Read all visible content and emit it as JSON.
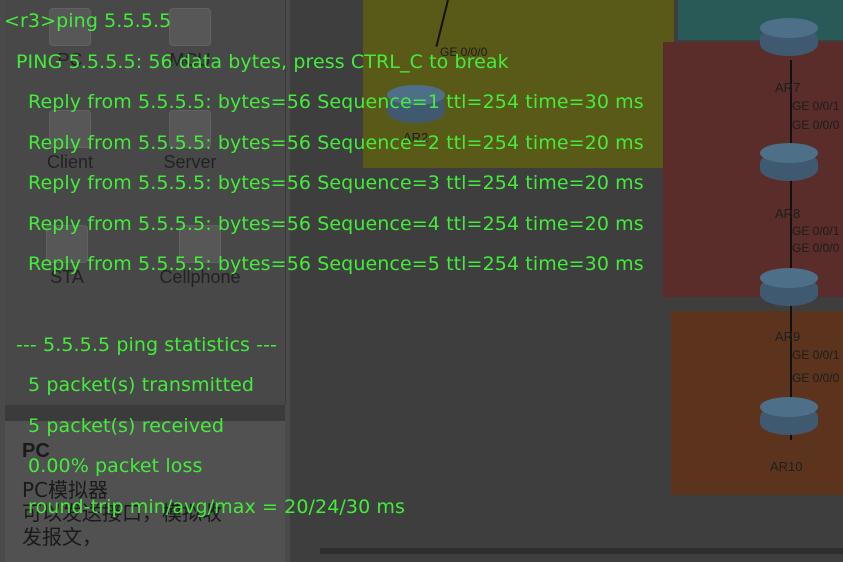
{
  "background": {
    "device_palette": [
      {
        "label": "PC",
        "icon": "pc-icon"
      },
      {
        "label": "MCU",
        "icon": "mcu-icon"
      },
      {
        "label": "Client",
        "icon": "client-icon"
      },
      {
        "label": "Server",
        "icon": "server-icon"
      },
      {
        "label": "STA",
        "icon": "sta-icon"
      },
      {
        "label": "Cellphone",
        "icon": "cellphone-icon"
      }
    ],
    "description": {
      "title": "PC",
      "lines": [
        "PC模拟器",
        "可以发送接口，模拟收",
        "发报文，"
      ]
    },
    "routers": [
      {
        "label": "AR7",
        "ports": [
          "GE 0/0/1",
          "GE 0/0/0"
        ]
      },
      {
        "label": "AR8",
        "ports": [
          "GE 0/0/1",
          "GE 0/0/0"
        ]
      },
      {
        "label": "AR9",
        "ports": [
          "GE 0/0/1",
          "GE 0/0/0"
        ]
      },
      {
        "label": "AR10",
        "ports": []
      },
      {
        "label": "AR2",
        "ports": [
          "GE 0/0/0"
        ]
      }
    ],
    "top_port": "GE 0/0/0",
    "colors": {
      "yellow_area": "#5a5a18",
      "red_area": "#5a2c2a",
      "orange_area": "#5c341e",
      "teal_area": "#2a5a58"
    }
  },
  "terminal": {
    "color": "#43ec3a",
    "prompt_line": "<r3>ping 5.5.5.5",
    "header": "PING 5.5.5.5: 56  data bytes, press CTRL_C to break",
    "replies": [
      "Reply from 5.5.5.5: bytes=56 Sequence=1 ttl=254 time=30 ms",
      "Reply from 5.5.5.5: bytes=56 Sequence=2 ttl=254 time=20 ms",
      "Reply from 5.5.5.5: bytes=56 Sequence=3 ttl=254 time=20 ms",
      "Reply from 5.5.5.5: bytes=56 Sequence=4 ttl=254 time=20 ms",
      "Reply from 5.5.5.5: bytes=56 Sequence=5 ttl=254 time=30 ms"
    ],
    "stats_header": "--- 5.5.5.5 ping statistics ---",
    "stats": [
      "5 packet(s) transmitted",
      "5 packet(s) received",
      "0.00% packet loss",
      "round-trip min/avg/max = 20/24/30 ms"
    ]
  }
}
